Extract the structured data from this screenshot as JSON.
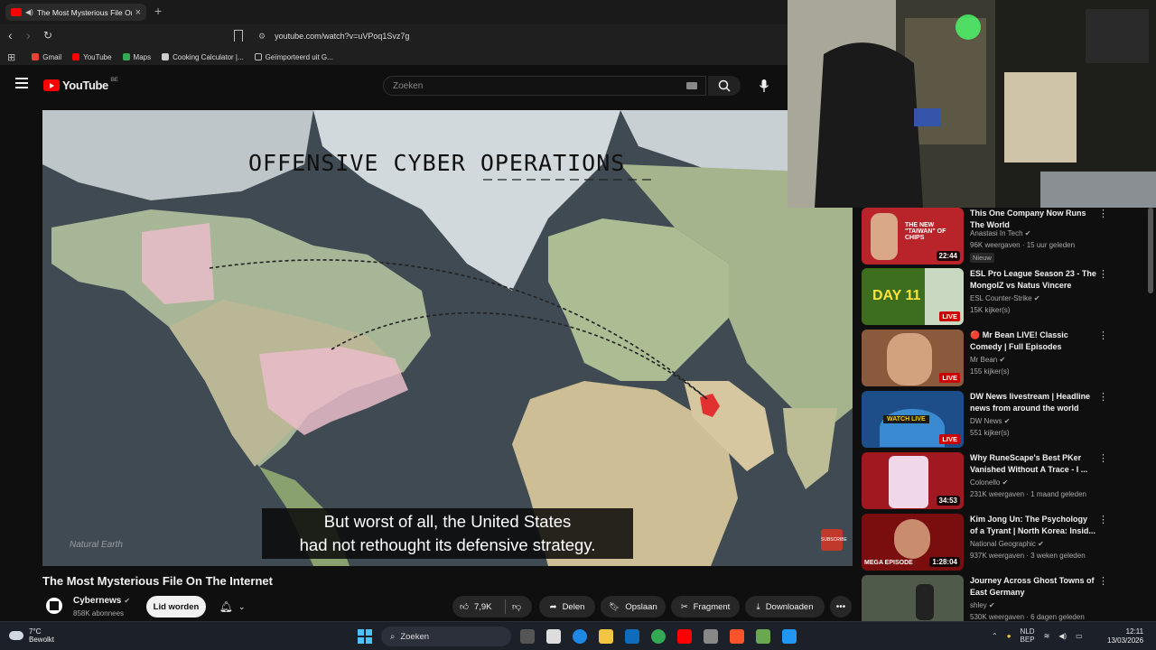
{
  "browser": {
    "tab_title": "The Most Mysterious File On",
    "url": "youtube.com/watch?v=uVPoq1Svz7g",
    "bookmarks": [
      {
        "label": "Gmail",
        "color": "#ea4335"
      },
      {
        "label": "YouTube",
        "color": "#ff0000"
      },
      {
        "label": "Maps",
        "color": "#34a853"
      },
      {
        "label": "Cooking Calculator |...",
        "color": "#cccccc"
      },
      {
        "label": "Geïmporteerd uit G...",
        "color": "#999999"
      }
    ]
  },
  "youtube": {
    "logo_text": "YouTube",
    "country": "BE",
    "search_placeholder": "Zoeken"
  },
  "video": {
    "overlay_title": "OFFENSIVE CYBER OPERATIONS",
    "subtitle_line1": "But worst of all, the United States",
    "subtitle_line2": "had not rethought its defensive strategy.",
    "map_credit": "Natural Earth",
    "watermark": "SUBSCRIBE",
    "title": "The Most Mysterious File On The Internet"
  },
  "channel": {
    "name": "Cybernews",
    "subscribers": "858K abonnees",
    "join_label": "Lid worden"
  },
  "actions": {
    "likes": "7,9K",
    "share": "Delen",
    "save": "Opslaan",
    "clip": "Fragment",
    "download": "Downloaden"
  },
  "recommendations": [
    {
      "title": "This One Company Now Runs The World",
      "channel": "Anastasi In Tech",
      "meta": "96K weergaven · 15 uur geleden",
      "badge": "Nieuw",
      "duration": "22:44",
      "live": false,
      "thumb": "#b8242a"
    },
    {
      "title": "ESL Pro League Season 23 - The MongolZ vs Natus Vincere",
      "channel": "ESL Counter-Strike",
      "meta": "15K kijker(s)",
      "badge": "",
      "duration": "",
      "live": true,
      "thumb": "#3c6e1e"
    },
    {
      "title": "🔴 Mr Bean LIVE! Classic Comedy | Full Episodes",
      "channel": "Mr Bean",
      "meta": "155 kijker(s)",
      "badge": "",
      "duration": "",
      "live": true,
      "thumb": "#8b5a3c"
    },
    {
      "title": "DW News livestream | Headline news from around the world",
      "channel": "DW News",
      "meta": "551 kijker(s)",
      "badge": "",
      "duration": "",
      "live": true,
      "thumb": "#1d4e8a"
    },
    {
      "title": "Why RuneScape's Best PKer Vanished Without A Trace - I ...",
      "channel": "Colonello",
      "meta": "231K weergaven · 1 maand geleden",
      "badge": "",
      "duration": "34:53",
      "live": false,
      "thumb": "#a01820"
    },
    {
      "title": "Kim Jong Un: The Psychology of a Tyrant | North Korea: Insid...",
      "channel": "National Geographic",
      "meta": "937K weergaven · 3 weken geleden",
      "badge": "",
      "duration": "1:28:04",
      "live": false,
      "thumb": "#7a0e0e"
    },
    {
      "title": "Journey Across Ghost Towns of East Germany",
      "channel": "shley",
      "meta": "530K weergaven · 6 dagen geleden",
      "badge": "",
      "duration": "",
      "live": false,
      "thumb": "#4f5a4a"
    }
  ],
  "live_label": "LIVE",
  "rec_thumb_texts": {
    "r0": "THE NEW \"TAIWAN\" OF CHIPS",
    "r1": "DAY 11",
    "r3": "WATCH LIVE",
    "r5": "MEGA EPISODE"
  },
  "taskbar": {
    "temp": "7°C",
    "weather": "Bewolkt",
    "search": "Zoeken",
    "lang1": "NLD",
    "lang2": "BEP",
    "time": "12:11",
    "date": "13/03/2026"
  }
}
